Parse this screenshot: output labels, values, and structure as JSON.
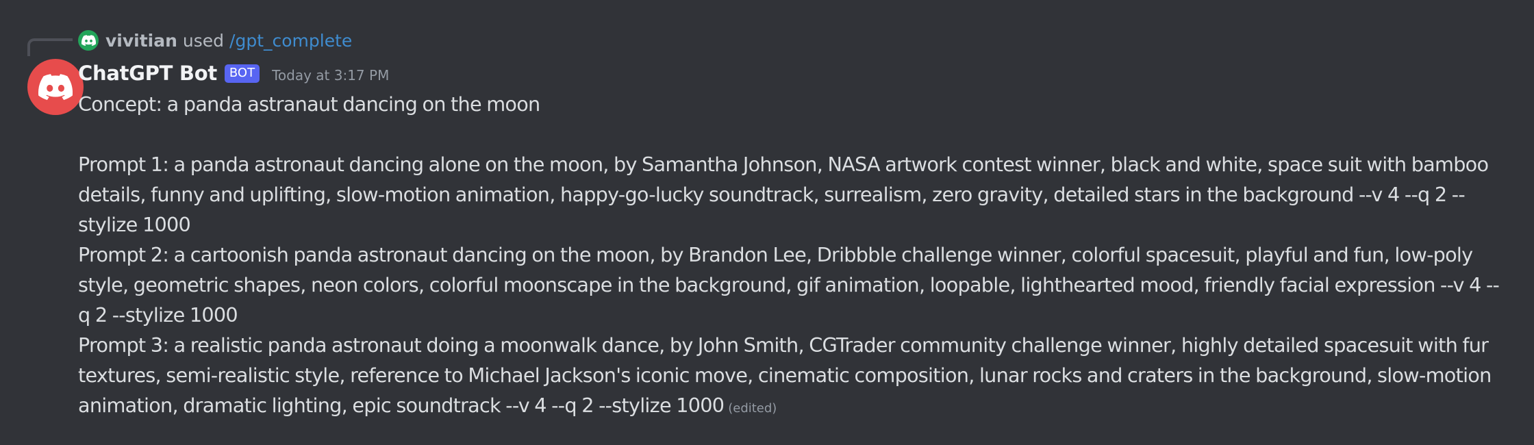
{
  "reply": {
    "username": "vivitian",
    "used_text": "used",
    "command": "/gpt_complete"
  },
  "message": {
    "author": "ChatGPT Bot",
    "badge": "BOT",
    "timestamp": "Today at 3:17 PM",
    "concept": "Concept: a panda astranaut dancing on the moon",
    "prompts": [
      "Prompt 1: a panda astronaut dancing alone on the moon, by Samantha Johnson, NASA artwork contest winner, black and white, space suit with bamboo details, funny and uplifting, slow-motion animation, happy-go-lucky soundtrack, surrealism, zero gravity, detailed stars in the background --v 4 --q 2 --stylize 1000",
      "Prompt 2: a cartoonish panda astronaut dancing on the moon, by Brandon Lee, Dribbble challenge winner, colorful spacesuit, playful and fun, low-poly style, geometric shapes, neon colors, colorful moonscape in the background, gif animation, loopable, lighthearted mood, friendly facial expression --v 4 --q 2 --stylize 1000",
      "Prompt 3: a realistic panda astronaut doing a moonwalk dance, by John Smith, CGTrader community challenge winner, highly detailed spacesuit with fur textures, semi-realistic style, reference to Michael Jackson's iconic move, cinematic composition, lunar rocks and craters in the background, slow-motion animation, dramatic lighting, epic soundtrack --v 4 --q 2 --stylize 1000"
    ],
    "edited_label": "(edited)"
  },
  "icons": {
    "reply_avatar": "discord-logo-icon",
    "author_avatar": "discord-logo-icon"
  },
  "colors": {
    "background": "#313338",
    "avatar": "#e74c4c",
    "reply_avatar": "#23a55a",
    "bot_badge": "#5865f2",
    "command_link": "#3f8ccf"
  }
}
